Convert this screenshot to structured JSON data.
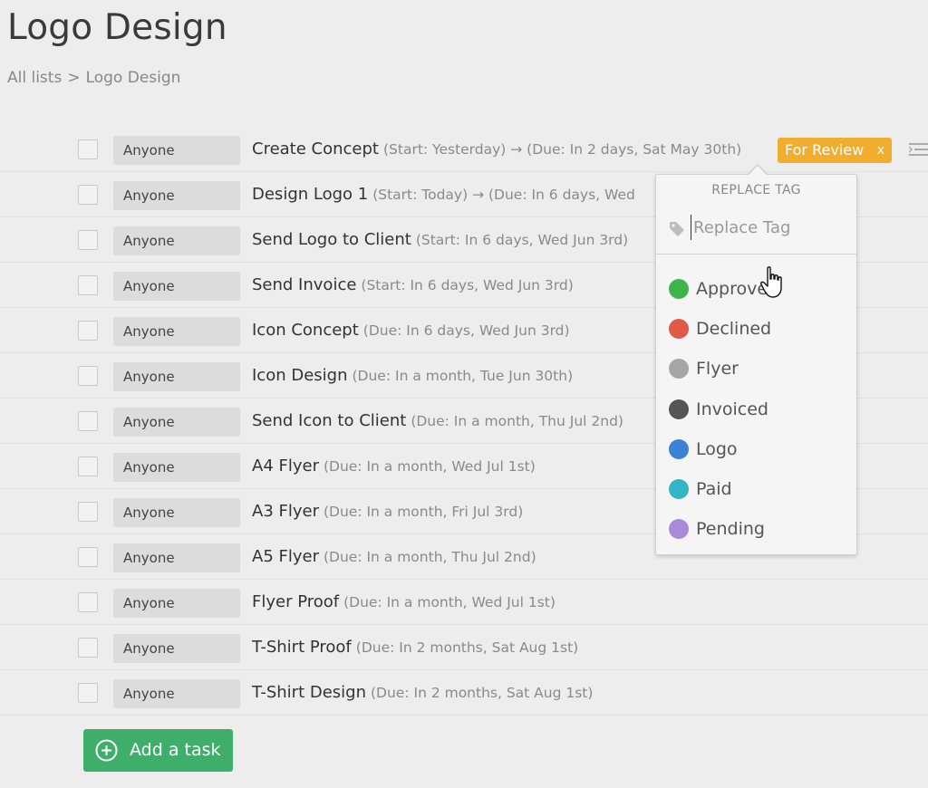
{
  "page": {
    "title": "Logo Design",
    "breadcrumb": {
      "root": "All lists",
      "separator": ">",
      "current": "Logo Design"
    }
  },
  "tasks": [
    {
      "assignee": "Anyone",
      "name": "Create Concept",
      "meta": "(Start: Yesterday) → (Due: In 2 days, Sat May 30th)"
    },
    {
      "assignee": "Anyone",
      "name": "Design Logo 1",
      "meta": "(Start: Today) → (Due: In 6 days, Wed"
    },
    {
      "assignee": "Anyone",
      "name": "Send Logo to Client",
      "meta": "(Start: In 6 days, Wed Jun 3rd)"
    },
    {
      "assignee": "Anyone",
      "name": "Send Invoice",
      "meta": "(Start: In 6 days, Wed Jun 3rd)"
    },
    {
      "assignee": "Anyone",
      "name": "Icon Concept",
      "meta": "(Due: In 6 days, Wed Jun 3rd)"
    },
    {
      "assignee": "Anyone",
      "name": "Icon Design",
      "meta": "(Due: In a month, Tue Jun 30th)"
    },
    {
      "assignee": "Anyone",
      "name": "Send Icon to Client",
      "meta": "(Due: In a month, Thu Jul 2nd)"
    },
    {
      "assignee": "Anyone",
      "name": "A4 Flyer",
      "meta": "(Due: In a month, Wed Jul 1st)"
    },
    {
      "assignee": "Anyone",
      "name": "A3 Flyer",
      "meta": "(Due: In a month, Fri Jul 3rd)"
    },
    {
      "assignee": "Anyone",
      "name": "A5 Flyer",
      "meta": "(Due: In a month, Thu Jul 2nd)"
    },
    {
      "assignee": "Anyone",
      "name": "Flyer Proof",
      "meta": "(Due: In a month, Wed Jul 1st)"
    },
    {
      "assignee": "Anyone",
      "name": "T-Shirt Proof",
      "meta": "(Due: In 2 months, Sat Aug 1st)"
    },
    {
      "assignee": "Anyone",
      "name": "T-Shirt Design",
      "meta": "(Due: In 2 months, Sat Aug 1st)"
    }
  ],
  "active_tag": {
    "label": "For Review",
    "remove": "x",
    "color": "#f0ad2e"
  },
  "add_task": {
    "label": "Add a task",
    "color": "#3fae6b"
  },
  "replace_tag_popup": {
    "header": "REPLACE TAG",
    "search_placeholder": "Replace Tag",
    "search_value": "",
    "options": [
      {
        "label": "Approve",
        "color": "#3db34a"
      },
      {
        "label": "Declined",
        "color": "#e05a4a"
      },
      {
        "label": "Flyer",
        "color": "#a6a6a6"
      },
      {
        "label": "Invoiced",
        "color": "#555555"
      },
      {
        "label": "Logo",
        "color": "#3a82d6"
      },
      {
        "label": "Paid",
        "color": "#32b6c4"
      },
      {
        "label": "Pending",
        "color": "#a88ad8"
      }
    ]
  },
  "icons": {
    "checkbox": "checkbox-icon",
    "row_menu": "row-menu-icon",
    "tag": "tag-icon",
    "add": "plus-circle-icon",
    "cursor": "hand-pointer-icon"
  }
}
